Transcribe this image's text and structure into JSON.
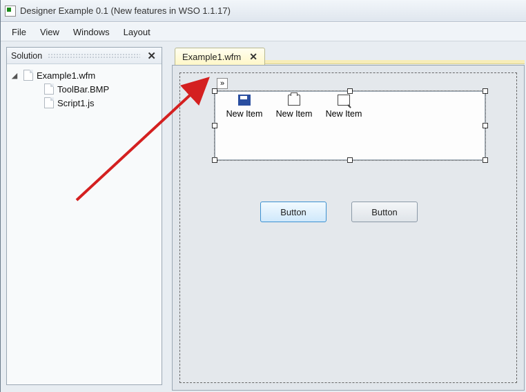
{
  "title": "Designer Example 0.1 (New features in WSO 1.1.17)",
  "menubar": {
    "items": [
      "File",
      "View",
      "Windows",
      "Layout"
    ]
  },
  "solution": {
    "title": "Solution",
    "root": {
      "label": "Example1.wfm"
    },
    "children": [
      {
        "label": "ToolBar.BMP"
      },
      {
        "label": "Script1.js"
      }
    ]
  },
  "document": {
    "tabs": [
      {
        "label": "Example1.wfm"
      }
    ],
    "toolbar_items": [
      {
        "icon": "save-icon",
        "label": "New Item"
      },
      {
        "icon": "print-icon",
        "label": "New Item"
      },
      {
        "icon": "search-icon",
        "label": "New Item"
      }
    ],
    "buttons": [
      {
        "label": "Button"
      },
      {
        "label": "Button"
      }
    ],
    "glyph": "»"
  },
  "colors": {
    "accent": "#3b90d0",
    "annotation": "#d42020"
  }
}
